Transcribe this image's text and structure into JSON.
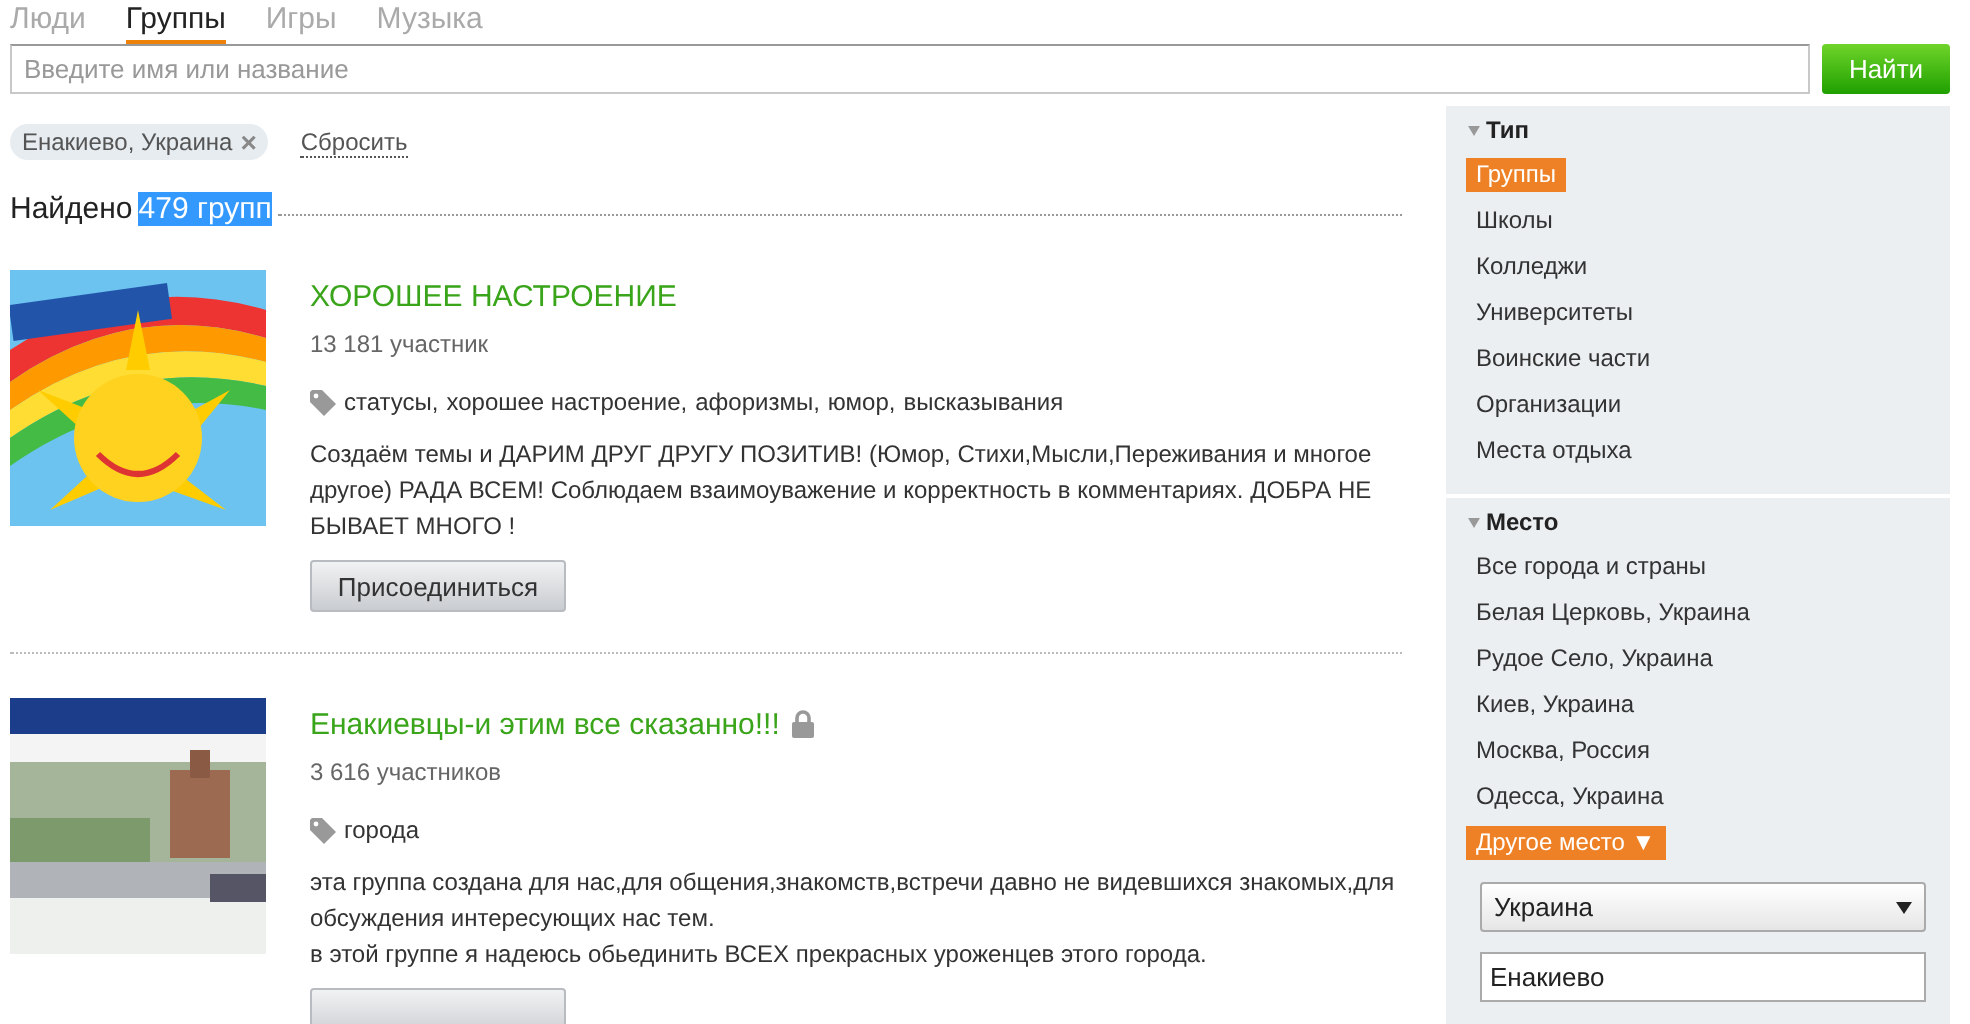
{
  "tabs": [
    {
      "label": "Люди",
      "selected": false
    },
    {
      "label": "Группы",
      "selected": true
    },
    {
      "label": "Игры",
      "selected": false
    },
    {
      "label": "Музыка",
      "selected": false
    }
  ],
  "search": {
    "placeholder": "Введите имя или название",
    "button": "Найти"
  },
  "filter": {
    "chip": "Енакиево, Украина",
    "chip_close": "×",
    "reset": "Сбросить"
  },
  "found": {
    "label": "Найдено",
    "count": "479 групп",
    "selected": true
  },
  "groups": [
    {
      "title": "ХОРОШЕЕ НАСТРОЕНИЕ",
      "locked": false,
      "members": "13 181 участник",
      "tags": [
        "статусы,",
        "хорошее настроение,",
        "афоризмы,",
        "юмор,",
        "высказывания"
      ],
      "description": [
        "Создаём темы и ДАРИМ ДРУГ ДРУГУ ПОЗИТИВ! (Юмор, Стихи,Мысли,Переживания и многое другое) РАДА ВСЕМ! Соблюдаем взаимоуважение и корректность в комментариях. ДОБРА НЕ БЫВАЕТ МНОГО !"
      ],
      "join": "Присоединиться"
    },
    {
      "title": "Енакиевцы-и этим все сказанно!!!",
      "locked": true,
      "members": "3 616 участников",
      "tags": [
        "города"
      ],
      "description": [
        "эта группа создана для нас,для общения,знакомств,встречи давно не видевшихся знакомых,для обсуждения интересующих нас тем.",
        "в этой группе я надеюсь обьединить ВСЕХ прекрасных уроженцев этого города."
      ],
      "join_cut": true
    }
  ],
  "sidebar": [
    {
      "title": "Тип",
      "expanded": true,
      "items": [
        {
          "label": "Группы",
          "selected": true
        },
        {
          "label": "Школы",
          "selected": false
        },
        {
          "label": "Колледжи",
          "selected": false
        },
        {
          "label": "Университеты",
          "selected": false
        },
        {
          "label": "Воинские части",
          "selected": false
        },
        {
          "label": "Организации",
          "selected": false
        },
        {
          "label": "Места отдыха",
          "selected": false
        }
      ]
    },
    {
      "title": "Место",
      "expanded": true,
      "items": [
        {
          "label": "Все города и страны",
          "selected": false
        },
        {
          "label": "Белая Церковь, Украина",
          "selected": false
        },
        {
          "label": "Рудое Село, Украина",
          "selected": false
        },
        {
          "label": "Киев, Украина",
          "selected": false
        },
        {
          "label": "Москва, Россия",
          "selected": false
        },
        {
          "label": "Одесса, Украина",
          "selected": false
        },
        {
          "label": "Другое место ▼",
          "selected": true
        }
      ],
      "country": "Украина",
      "city": "Енакиево"
    }
  ]
}
